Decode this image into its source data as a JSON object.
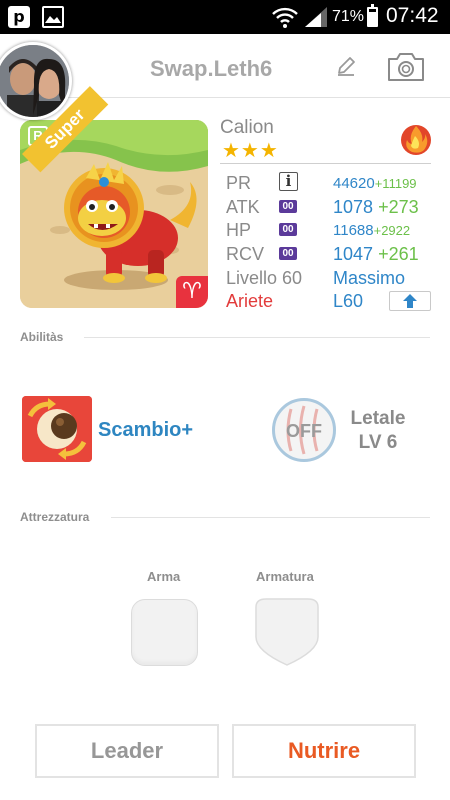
{
  "status_bar": {
    "app_icon_letter": "p",
    "battery_percent": "71%",
    "time": "07:42"
  },
  "profile": {
    "username": "Swap.Leth6"
  },
  "monster": {
    "rarity_badge": "R",
    "rank_ribbon": "Super",
    "name": "Calion",
    "stars": "★★★",
    "element": "fire",
    "stats": {
      "pr_label": "PR",
      "pr_value": "44620",
      "pr_bonus": "+11199",
      "atk_label": "ATK",
      "atk_badge": "00",
      "atk_value": "1078",
      "atk_bonus": "+273",
      "hp_label": "HP",
      "hp_badge": "00",
      "hp_value": "11688",
      "hp_bonus": "+2922",
      "rcv_label": "RCV",
      "rcv_badge": "00",
      "rcv_value": "1047",
      "rcv_bonus": "+261"
    },
    "level_label": "Livello 60",
    "level_value": "Massimo",
    "zodiac": "Ariete",
    "zodiac_symbol": "♈",
    "level_code": "L60"
  },
  "abilities": {
    "title": "Abilitàs",
    "skill_name": "Scambio+",
    "toggle_label": "OFF",
    "skill2_name": "Letale",
    "skill2_level": "LV 6"
  },
  "equipment": {
    "title": "Attrezzatura",
    "weapon_label": "Arma",
    "armor_label": "Armatura"
  },
  "buttons": {
    "leader": "Leader",
    "feed": "Nutrire"
  },
  "colors": {
    "accent_blue": "#2f86c8",
    "bonus_green": "#6cc04a",
    "zodiac_red": "#e23b3b",
    "feed_orange": "#e95a23"
  }
}
